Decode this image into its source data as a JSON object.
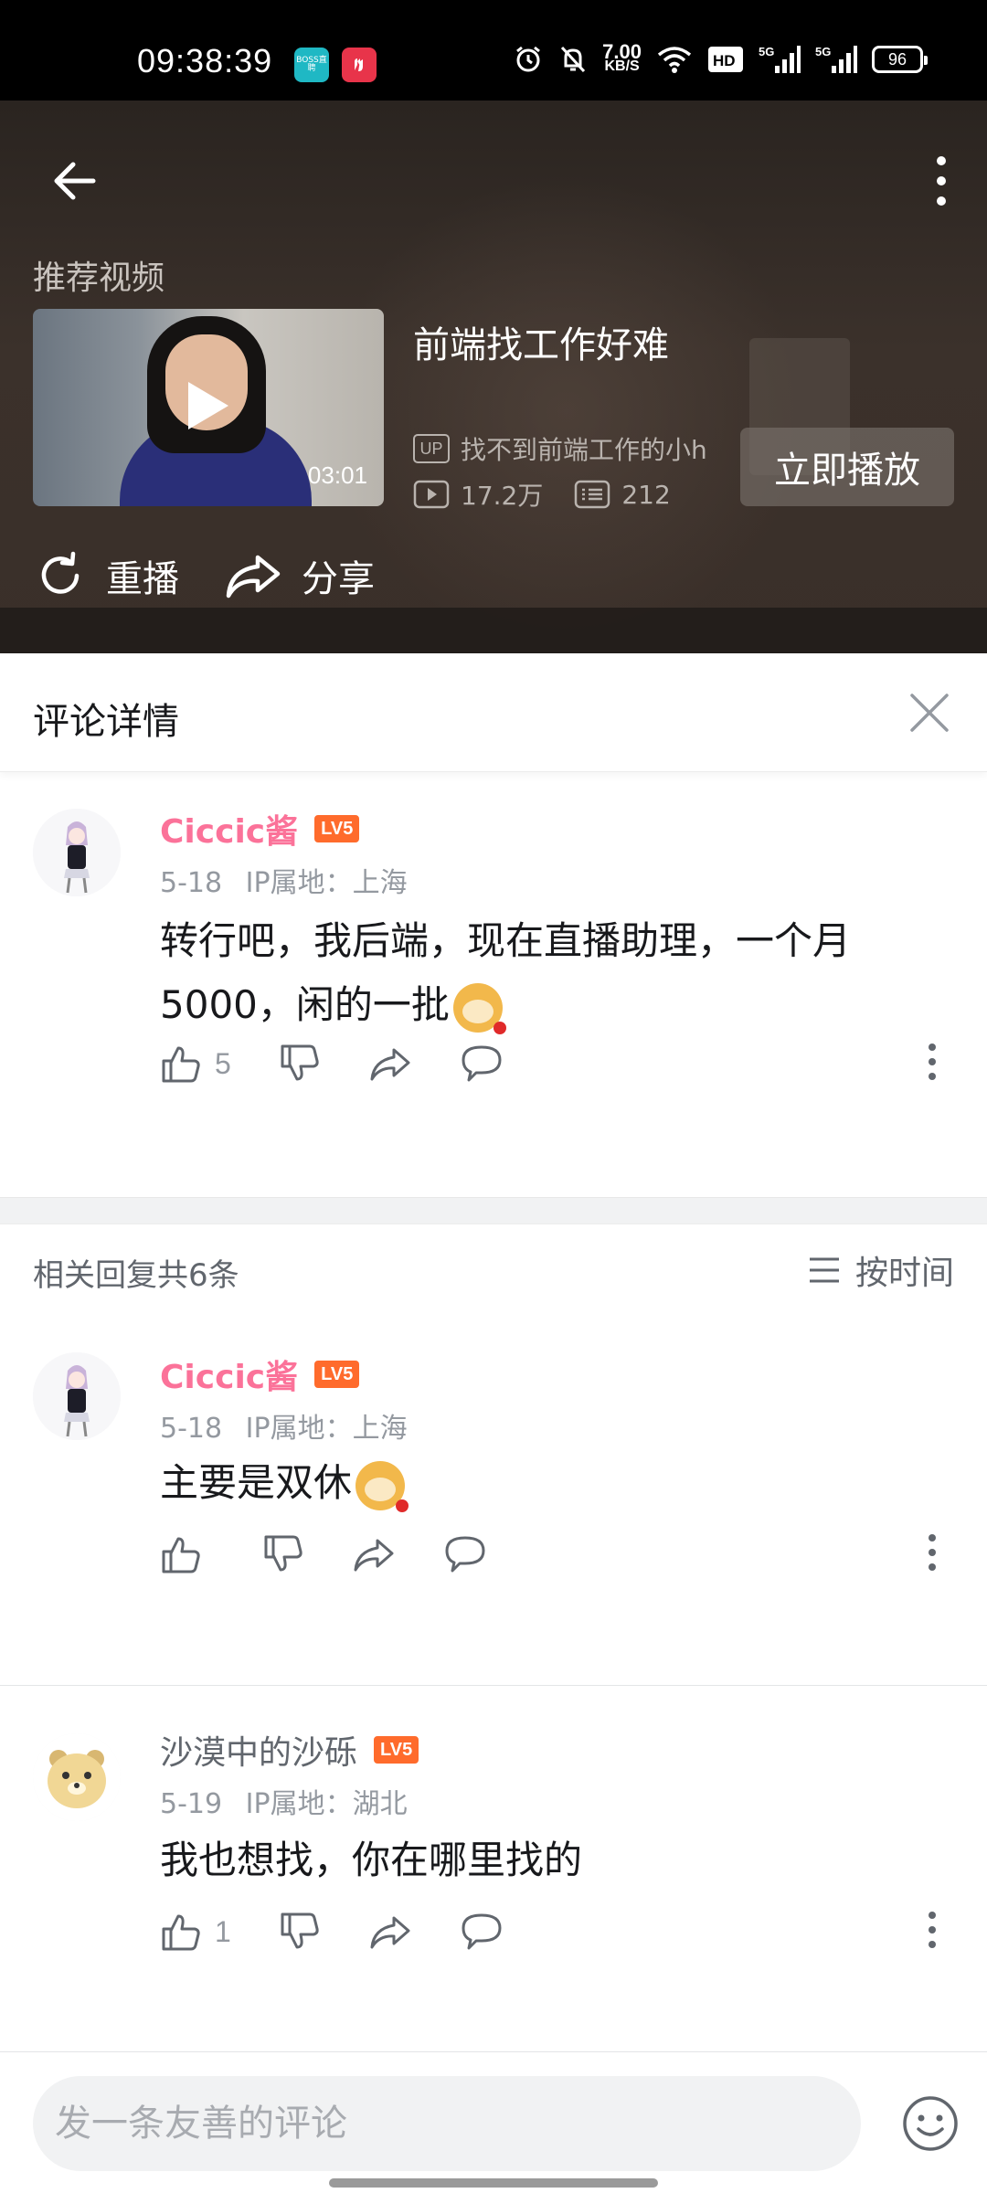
{
  "status_bar": {
    "time": "09:38:39",
    "badge_boss": "BOSS直聘",
    "badge_red": "",
    "net_speed_value": "7.00",
    "net_speed_unit": "KB/S",
    "hd_label": "HD",
    "signal1_label": "5G",
    "signal2_label": "5G",
    "battery": "96"
  },
  "video": {
    "back_icon": "arrow-left-icon",
    "more_icon": "vertical-dots-icon",
    "recommend_label": "推荐视频",
    "rec_title": "前端找工作好难",
    "duration": "03:01",
    "up_tag": "UP",
    "up_name": "找不到前端工作的小h",
    "views": "17.2万",
    "danmaku": "212",
    "play_now": "立即播放",
    "replay": "重播",
    "share": "分享"
  },
  "sheet": {
    "title": "评论详情",
    "close_icon": "close-icon"
  },
  "main_comment": {
    "username": "Ciccic酱",
    "level": "LV5",
    "date": "5-18",
    "ip": "IP属地：上海",
    "text": "转行吧，我后端，现在直播助理，一个月5000，闲的一批",
    "likes": "5"
  },
  "replies_header": {
    "count_text": "相关回复共6条",
    "sort_text": "按时间"
  },
  "replies": [
    {
      "username": "Ciccic酱",
      "level": "LV5",
      "date": "5-18",
      "ip": "IP属地：上海",
      "text": "主要是双休",
      "likes": ""
    },
    {
      "username": "沙漠中的沙砾",
      "level": "LV5",
      "date": "5-19",
      "ip": "IP属地：湖北",
      "text": "我也想找，你在哪里找的",
      "likes": "1"
    }
  ],
  "input": {
    "placeholder": "发一条友善的评论"
  },
  "colors": {
    "pink": "#fb7299",
    "level_orange": "#ff6b2c",
    "grey_text": "#9499a0"
  }
}
